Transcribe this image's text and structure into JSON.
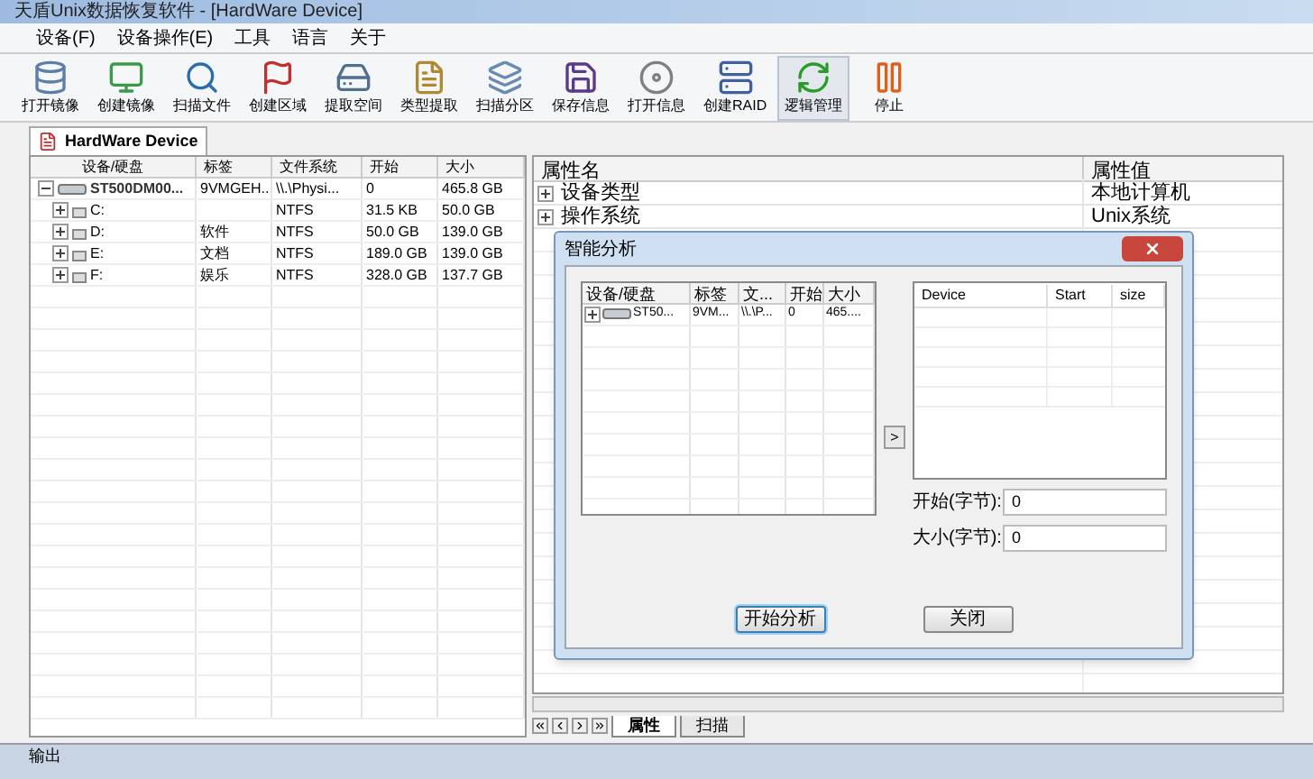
{
  "window": {
    "title": "天盾Unix数据恢复软件 - [HardWare Device]"
  },
  "menu": [
    "设备(F)",
    "设备操作(E)",
    "工具",
    "语言",
    "关于"
  ],
  "toolbar": [
    {
      "label": "打开镜像",
      "selected": false
    },
    {
      "label": "创建镜像",
      "selected": false
    },
    {
      "label": "扫描文件",
      "selected": false
    },
    {
      "label": "创建区域",
      "selected": false
    },
    {
      "label": "提取空间",
      "selected": false
    },
    {
      "label": "类型提取",
      "selected": false
    },
    {
      "label": "扫描分区",
      "selected": false
    },
    {
      "label": "保存信息",
      "selected": false
    },
    {
      "label": "打开信息",
      "selected": false
    },
    {
      "label": "创建RAID",
      "selected": false
    },
    {
      "label": "逻辑管理",
      "selected": true
    },
    {
      "label": "停止",
      "selected": false
    }
  ],
  "doc_tab": {
    "label": "HardWare Device"
  },
  "device_table": {
    "columns": [
      "设备/硬盘",
      "标签",
      "文件系统",
      "开始",
      "大小"
    ],
    "rows": [
      {
        "cells": [
          "ST500DM00...",
          "9VMGEH...",
          "\\\\.\\Physi...",
          "0",
          "465.8 GB"
        ],
        "expanded": true,
        "children": [
          {
            "cells": [
              "C:",
              "",
              "NTFS",
              "31.5 KB",
              "50.0 GB"
            ],
            "expanded": false
          },
          {
            "cells": [
              "D:",
              "软件",
              "NTFS",
              "50.0 GB",
              "139.0 GB"
            ],
            "expanded": false
          },
          {
            "cells": [
              "E:",
              "文档",
              "NTFS",
              "189.0 GB",
              "139.0 GB"
            ],
            "expanded": false
          },
          {
            "cells": [
              "F:",
              "娱乐",
              "NTFS",
              "328.0 GB",
              "137.7 GB"
            ],
            "expanded": false
          }
        ]
      }
    ]
  },
  "property_grid": {
    "columns": [
      "属性名",
      "属性值"
    ],
    "rows": [
      {
        "name": "设备类型",
        "value": "本地计算机",
        "expanded": false
      },
      {
        "name": "操作系统",
        "value": "Unix系统",
        "expanded": false
      }
    ]
  },
  "bottom_tabs": [
    {
      "label": "属性",
      "selected": true
    },
    {
      "label": "扫描",
      "selected": false
    }
  ],
  "output_panel": {
    "title": "输出"
  },
  "dialog": {
    "title": "智能分析",
    "device_table": {
      "columns": [
        "设备/硬盘",
        "标签",
        "文...",
        "开始",
        "大小"
      ],
      "rows": [
        {
          "cells": [
            "ST50...",
            "9VM...",
            "\\\\.\\P...",
            "0",
            "465...."
          ],
          "expanded": false
        }
      ]
    },
    "add_button": ">",
    "result_table": {
      "columns": [
        "Device",
        "Start",
        "size"
      ]
    },
    "fields": [
      {
        "label": "开始(字节):",
        "value": "0"
      },
      {
        "label": "大小(字节):",
        "value": "0"
      }
    ],
    "buttons": [
      {
        "label": "开始分析",
        "selected": true
      },
      {
        "label": "关闭",
        "selected": false
      }
    ]
  }
}
